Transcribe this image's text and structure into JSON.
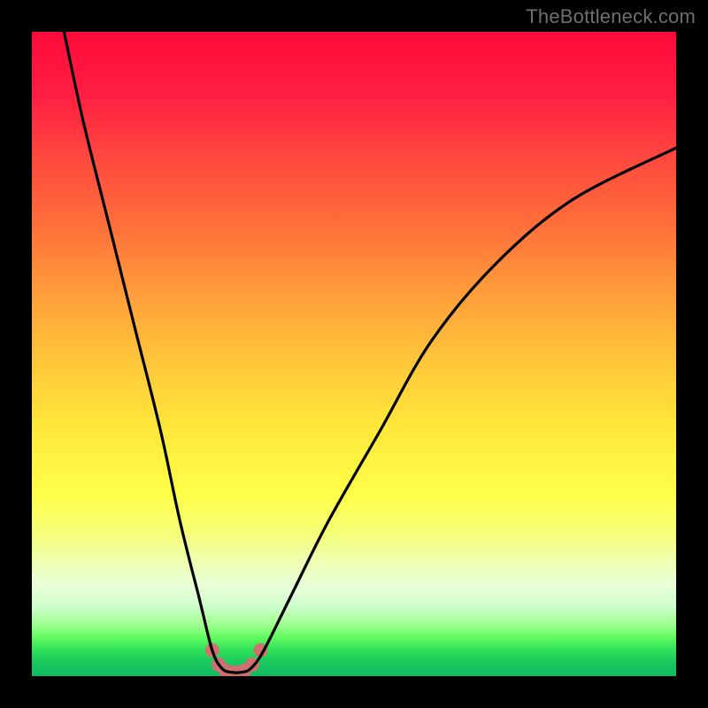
{
  "watermark": {
    "text": "TheBottleneck.com"
  },
  "chart_data": {
    "type": "line",
    "title": "",
    "xlabel": "",
    "ylabel": "",
    "xlim": [
      0,
      100
    ],
    "ylim": [
      0,
      100
    ],
    "grid": false,
    "series": [
      {
        "name": "curve",
        "color": "#000000",
        "x": [
          5,
          8,
          12,
          16,
          20,
          23,
          26,
          28,
          29.5,
          31,
          32.5,
          34,
          36,
          40,
          46,
          54,
          62,
          72,
          84,
          100
        ],
        "y": [
          100,
          86,
          70,
          54,
          38,
          24,
          12,
          4,
          1.2,
          0.6,
          0.6,
          1.2,
          4,
          12,
          24,
          38,
          52,
          64,
          74,
          82
        ]
      }
    ],
    "markers": [
      {
        "name": "marker-1",
        "x": 28.0,
        "y": 4.0,
        "color": "#d07070",
        "r": 8
      },
      {
        "name": "marker-2",
        "x": 29.0,
        "y": 1.8,
        "color": "#d07070",
        "r": 8
      },
      {
        "name": "marker-3",
        "x": 30.0,
        "y": 0.9,
        "color": "#d07070",
        "r": 8
      },
      {
        "name": "marker-4",
        "x": 31.5,
        "y": 0.6,
        "color": "#d07070",
        "r": 8
      },
      {
        "name": "marker-5",
        "x": 33.0,
        "y": 0.9,
        "color": "#d07070",
        "r": 8
      },
      {
        "name": "marker-6",
        "x": 34.2,
        "y": 1.8,
        "color": "#d07070",
        "r": 8
      },
      {
        "name": "marker-7",
        "x": 35.5,
        "y": 4.0,
        "color": "#d07070",
        "r": 8
      }
    ],
    "gradient_stops": [
      {
        "pct": 0,
        "color": "#ff0a3a"
      },
      {
        "pct": 30,
        "color": "#ff6f3a"
      },
      {
        "pct": 62,
        "color": "#ffe93a"
      },
      {
        "pct": 82,
        "color": "#f0ffb0"
      },
      {
        "pct": 94,
        "color": "#60fa60"
      },
      {
        "pct": 100,
        "color": "#12b860"
      }
    ]
  }
}
